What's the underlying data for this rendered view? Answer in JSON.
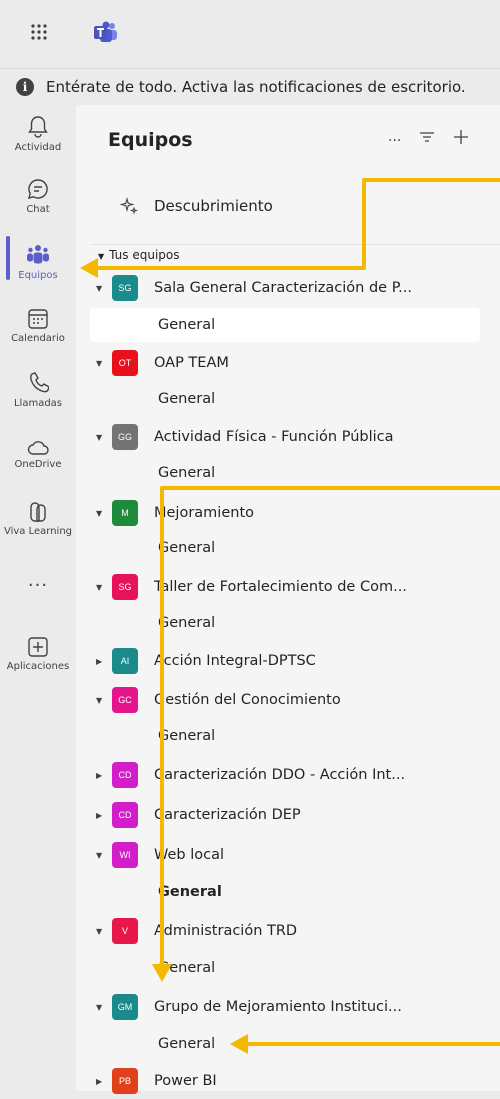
{
  "notification": {
    "text": "Entérate de todo. Activa las notificaciones de escritorio.",
    "icon": "info-icon"
  },
  "rail": {
    "items": [
      {
        "label": "Actividad",
        "icon": "bell-icon"
      },
      {
        "label": "Chat",
        "icon": "chat-icon"
      },
      {
        "label": "Equipos",
        "icon": "teams-people-icon",
        "active": true
      },
      {
        "label": "Calendario",
        "icon": "calendar-icon"
      },
      {
        "label": "Llamadas",
        "icon": "phone-icon"
      },
      {
        "label": "OneDrive",
        "icon": "cloud-icon"
      },
      {
        "label": "Viva Learning",
        "icon": "viva-learning-icon"
      },
      {
        "label": "...",
        "icon": "more-icon"
      },
      {
        "label": "Aplicaciones",
        "icon": "add-apps-icon"
      }
    ]
  },
  "panel": {
    "title": "Equipos",
    "more_label": "...",
    "discover_label": "Descubrimiento",
    "section_label": "Tus equipos"
  },
  "teams": [
    {
      "initials": "SG",
      "name": "Sala General Caracterización de P...",
      "color": "#1a8a8a",
      "expanded": true,
      "channel": "General",
      "selected": true
    },
    {
      "initials": "OT",
      "name": "OAP TEAM",
      "color": "#e8101a",
      "expanded": true,
      "channel": "General"
    },
    {
      "initials": "GG",
      "name": "Actividad Física - Función Pública",
      "color": "#737373",
      "expanded": true,
      "channel": "General"
    },
    {
      "initials": "M",
      "name": "Mejoramiento",
      "color": "#1e8a3c",
      "expanded": true,
      "channel": "General"
    },
    {
      "initials": "SG",
      "name": "Taller de Fortalecimiento de Com...",
      "color": "#e8125c",
      "expanded": true,
      "channel": "General"
    },
    {
      "initials": "AI",
      "name": "Acción Integral-DPTSC",
      "color": "#1a8a8a",
      "expanded": false
    },
    {
      "initials": "GC",
      "name": "Gestión del Conocimiento",
      "color": "#e3168c",
      "expanded": true,
      "channel": "General"
    },
    {
      "initials": "CD",
      "name": "Caracterización DDO - Acción Int...",
      "color": "#d21ec8",
      "expanded": false
    },
    {
      "initials": "CD",
      "name": "Caracterización DEP",
      "color": "#d21ec8",
      "expanded": false
    },
    {
      "initials": "WI",
      "name": "Web local",
      "color": "#d21ec8",
      "expanded": true,
      "channel": "General",
      "bold": true
    },
    {
      "initials": "V",
      "name": "Administración TRD",
      "color": "#e8174a",
      "expanded": true,
      "channel": "General"
    },
    {
      "initials": "GM",
      "name": "Grupo de Mejoramiento Instituci...",
      "color": "#1a8a8a",
      "expanded": true,
      "channel": "General"
    },
    {
      "initials": "PB",
      "name": "Power BI",
      "color": "#e0401a",
      "expanded": false
    }
  ],
  "annotation_color": "#f5b800"
}
